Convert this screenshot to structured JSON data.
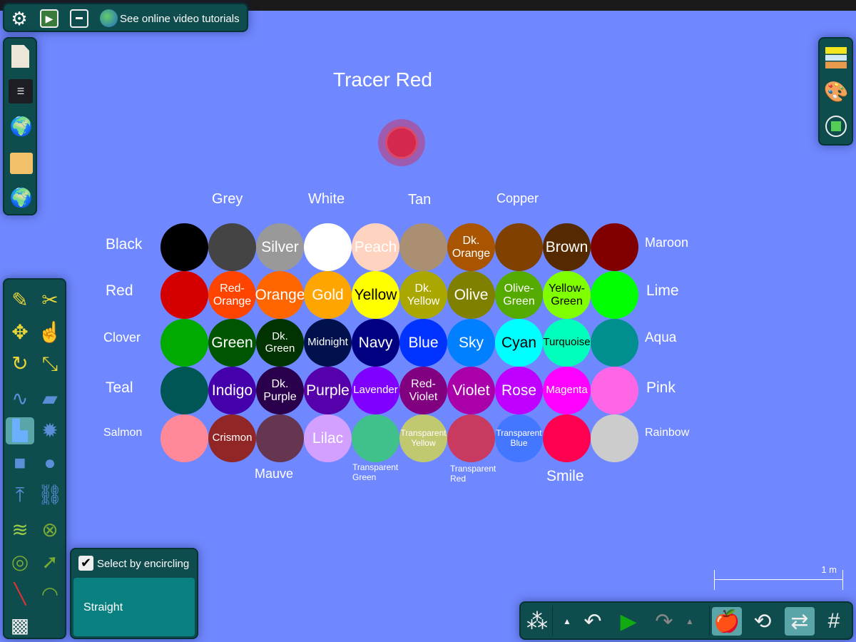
{
  "top_toolbar": {
    "tutorials_label": "See online video tutorials",
    "icons": [
      "gear-icon",
      "play-scene-icon",
      "window-icon",
      "globe-icon"
    ]
  },
  "file_toolbar": {
    "icons": [
      "new-scene-icon",
      "save-icon",
      "share-scene-icon",
      "open-folder-icon",
      "browse-online-icon"
    ]
  },
  "right_toolbar": {
    "icons": [
      "materials-icon",
      "palette-icon",
      "transform-icon"
    ]
  },
  "title": "Tracer Red",
  "tracer_color": "#d4284f",
  "background_color": "#7088ff",
  "grid": {
    "swatches": [
      {
        "label": "",
        "color": "#000000",
        "text": "#ffffff"
      },
      {
        "label": "",
        "color": "#444444",
        "text": "#ffffff"
      },
      {
        "label": "Silver",
        "color": "#999999",
        "text": "#ffffff"
      },
      {
        "label": "",
        "color": "#ffffff",
        "text": "#ffffff"
      },
      {
        "label": "Peach",
        "color": "#ffd3bf",
        "text": "#ffffff"
      },
      {
        "label": "",
        "color": "#aa8f73",
        "text": "#ffffff"
      },
      {
        "label": "Dk.\nOrange",
        "color": "#a85400",
        "text": "#ffffff"
      },
      {
        "label": "",
        "color": "#7f4000",
        "text": "#ffffff"
      },
      {
        "label": "Brown",
        "color": "#552a00",
        "text": "#ffffff"
      },
      {
        "label": "",
        "color": "#800000",
        "text": "#ffffff"
      },
      {
        "label": "",
        "color": "#d40000",
        "text": "#ffffff"
      },
      {
        "label": "Red-\nOrange",
        "color": "#ff4400",
        "text": "#ffffff"
      },
      {
        "label": "Orange",
        "color": "#ff6600",
        "text": "#ffffff"
      },
      {
        "label": "Gold",
        "color": "#ffa500",
        "text": "#ffffff"
      },
      {
        "label": "Yellow",
        "color": "#ffff00",
        "text": "#000000"
      },
      {
        "label": "Dk.\nYellow",
        "color": "#aaa800",
        "text": "#ffffff"
      },
      {
        "label": "Olive",
        "color": "#7f7f00",
        "text": "#ffffff"
      },
      {
        "label": "Olive-\nGreen",
        "color": "#55aa00",
        "text": "#ffffff"
      },
      {
        "label": "Yellow-\nGreen",
        "color": "#80ff00",
        "text": "#000000"
      },
      {
        "label": "",
        "color": "#00ff00",
        "text": "#ffffff"
      },
      {
        "label": "",
        "color": "#00aa00",
        "text": "#ffffff"
      },
      {
        "label": "Green",
        "color": "#005500",
        "text": "#ffffff"
      },
      {
        "label": "Dk. Green",
        "color": "#003300",
        "text": "#ffffff"
      },
      {
        "label": "Midnight",
        "color": "#00114d",
        "text": "#ffffff"
      },
      {
        "label": "Navy",
        "color": "#000080",
        "text": "#ffffff"
      },
      {
        "label": "Blue",
        "color": "#0033ff",
        "text": "#ffffff"
      },
      {
        "label": "Sky",
        "color": "#0080ff",
        "text": "#ffffff"
      },
      {
        "label": "Cyan",
        "color": "#00ffff",
        "text": "#000000"
      },
      {
        "label": "Turquoise",
        "color": "#00ffbb",
        "text": "#000000"
      },
      {
        "label": "",
        "color": "#008e8e",
        "text": "#ffffff"
      },
      {
        "label": "",
        "color": "#005555",
        "text": "#ffffff"
      },
      {
        "label": "Indigo",
        "color": "#4400aa",
        "text": "#ffffff"
      },
      {
        "label": "Dk.\nPurple",
        "color": "#2a004d",
        "text": "#ffffff"
      },
      {
        "label": "Purple",
        "color": "#5500aa",
        "text": "#ffffff"
      },
      {
        "label": "Lavender",
        "color": "#8000ff",
        "text": "#ffffff"
      },
      {
        "label": "Red-\nViolet",
        "color": "#800080",
        "text": "#ffffff"
      },
      {
        "label": "Violet",
        "color": "#aa00aa",
        "text": "#ffffff"
      },
      {
        "label": "Rose",
        "color": "#bf00ff",
        "text": "#ffffff"
      },
      {
        "label": "Magenta",
        "color": "#ff00ff",
        "text": "#ffffff"
      },
      {
        "label": "",
        "color": "#ff66e6",
        "text": "#ffffff"
      },
      {
        "label": "",
        "color": "#ff8899",
        "text": "#ffffff"
      },
      {
        "label": "Crismon",
        "color": "#912626",
        "text": "#ffffff"
      },
      {
        "label": "",
        "color": "#663650",
        "text": "#ffffff"
      },
      {
        "label": "Lilac",
        "color": "#d4a0ff",
        "text": "#ffffff"
      },
      {
        "label": "",
        "color": "#40c08a",
        "text": "#ffffff"
      },
      {
        "label": "Transparent\nYellow",
        "color": "#c0c870",
        "text": "#ffffff"
      },
      {
        "label": "",
        "color": "#c83a60",
        "text": "#ffffff"
      },
      {
        "label": "Transparent\nBlue",
        "color": "#4477ff",
        "text": "#ffffff"
      },
      {
        "label": "",
        "color": "#ff0050",
        "text": "#ffffff"
      },
      {
        "label": "",
        "color": "#cccccc",
        "text": "#ffffff"
      }
    ],
    "outer_labels": [
      "Grey",
      "White",
      "Tan",
      "Copper",
      "Black",
      "Red",
      "Clover",
      "Teal",
      "Salmon",
      "Maroon",
      "Lime",
      "Aqua",
      "Pink",
      "Rainbow",
      "Mauve",
      "Transparent\nGreen",
      "Transparent\nRed",
      "Smile"
    ]
  },
  "tools": {
    "icons": [
      "sketch-icon",
      "cut-icon",
      "move-icon",
      "drag-icon",
      "rotate-icon",
      "scale-icon",
      "rope-icon",
      "eraser-icon",
      "brush-icon",
      "gear-shape-icon",
      "box-icon",
      "circle-icon",
      "plane-icon",
      "chain-icon",
      "spring-icon",
      "fixate-icon",
      "hinge-icon",
      "tracer-tool-icon",
      "laser-icon",
      "thruster-icon",
      "texture-icon"
    ],
    "selected": "brush-icon"
  },
  "options": {
    "select_by_encircling": "Select by encircling",
    "checked": true,
    "mode": "Straight"
  },
  "scale": {
    "label": "1 m"
  },
  "bottom_toolbar": {
    "icons": [
      "zoom-grid-icon",
      "undo-menu-icon",
      "undo-icon",
      "play-icon",
      "redo-icon",
      "redo-menu-icon",
      "gravity-icon",
      "rotate-view-icon",
      "air-friction-icon",
      "grid-icon"
    ]
  }
}
